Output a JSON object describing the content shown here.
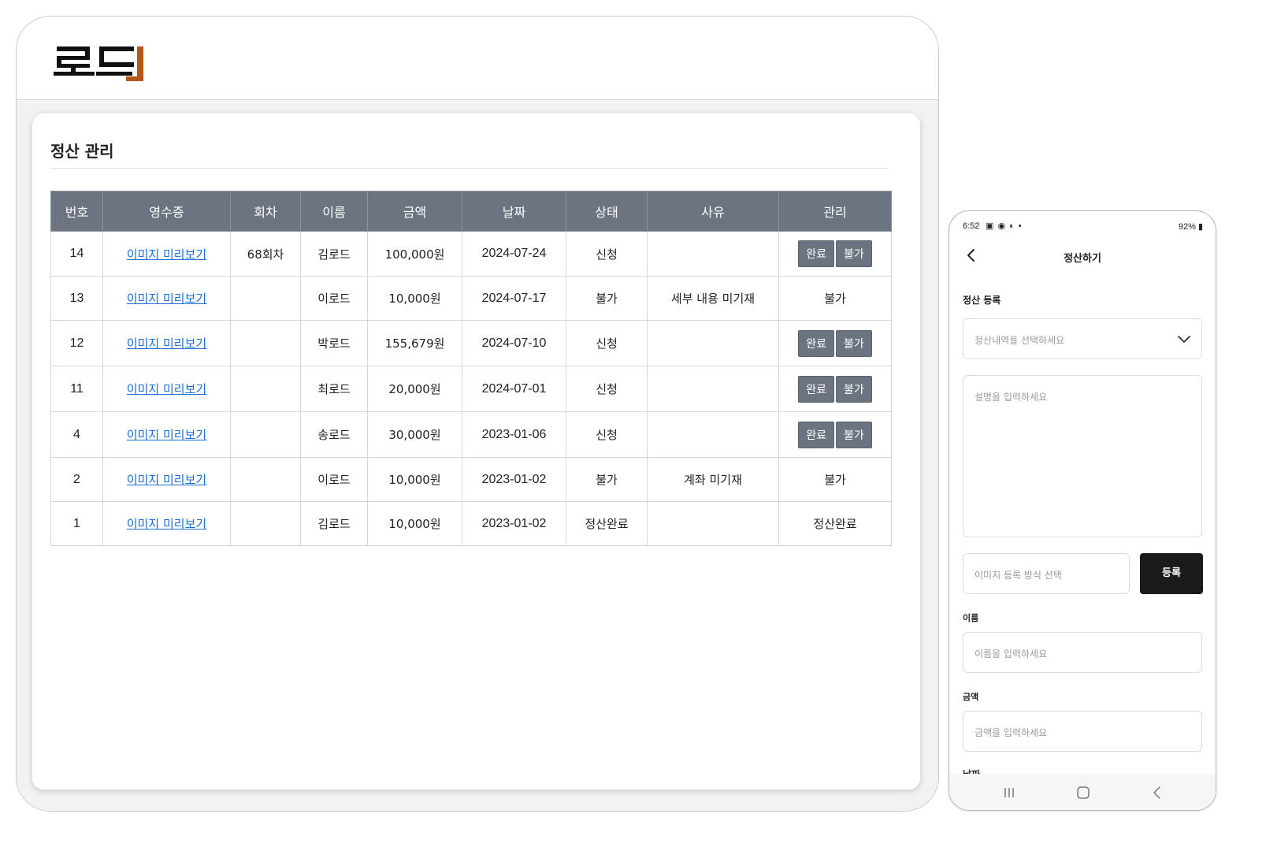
{
  "desktop": {
    "logo": {
      "text": "로드",
      "accent_color": "#b5561c"
    },
    "page_title": "정산 관리",
    "table": {
      "headers": [
        "번호",
        "영수증",
        "회차",
        "이름",
        "금액",
        "날짜",
        "상태",
        "사유",
        "관리"
      ],
      "rows": [
        {
          "no": "14",
          "receipt": "이미지 미리보기",
          "round": "68회차",
          "name": "김로드",
          "amount": "100,000원",
          "date": "2024-07-24",
          "status": "신청",
          "reason": "",
          "manage": "",
          "buttons": [
            "완료",
            "불가"
          ]
        },
        {
          "no": "13",
          "receipt": "이미지 미리보기",
          "round": "",
          "name": "이로드",
          "amount": "10,000원",
          "date": "2024-07-17",
          "status": "불가",
          "reason": "세부 내용 미기재",
          "manage": "불가",
          "buttons": []
        },
        {
          "no": "12",
          "receipt": "이미지 미리보기",
          "round": "",
          "name": "박로드",
          "amount": "155,679원",
          "date": "2024-07-10",
          "status": "신청",
          "reason": "",
          "manage": "",
          "buttons": [
            "완료",
            "불가"
          ]
        },
        {
          "no": "11",
          "receipt": "이미지 미리보기",
          "round": "",
          "name": "최로드",
          "amount": "20,000원",
          "date": "2024-07-01",
          "status": "신청",
          "reason": "",
          "manage": "",
          "buttons": [
            "완료",
            "불가"
          ]
        },
        {
          "no": "4",
          "receipt": "이미지 미리보기",
          "round": "",
          "name": "송로드",
          "amount": "30,000원",
          "date": "2023-01-06",
          "status": "신청",
          "reason": "",
          "manage": "",
          "buttons": [
            "완료",
            "불가"
          ]
        },
        {
          "no": "2",
          "receipt": "이미지 미리보기",
          "round": "",
          "name": "이로드",
          "amount": "10,000원",
          "date": "2023-01-02",
          "status": "불가",
          "reason": "계좌 미기재",
          "manage": "불가",
          "buttons": []
        },
        {
          "no": "1",
          "receipt": "이미지 미리보기",
          "round": "",
          "name": "김로드",
          "amount": "10,000원",
          "date": "2023-01-02",
          "status": "정산완료",
          "reason": "",
          "manage": "정산완료",
          "buttons": []
        }
      ]
    }
  },
  "mobile": {
    "status_bar": {
      "time": "6:52",
      "battery": "92%"
    },
    "title": "정산하기",
    "section_label": "정산 등록",
    "select_placeholder": "정산내역을 선택하세요",
    "description_placeholder": "설명을 입력하세요",
    "image_method_placeholder": "이미지 등록 방식 선택",
    "register_button": "등록",
    "name_label": "이름",
    "name_placeholder": "이름을 입력하세요",
    "amount_label": "금액",
    "amount_placeholder": "금액을 입력하세요",
    "date_label": "날짜"
  },
  "icons": {
    "back": "chevron-left-icon",
    "dropdown": "chevron-down-icon",
    "nav_recent": "recent-apps-icon",
    "nav_home": "home-icon",
    "nav_back": "nav-back-icon"
  }
}
